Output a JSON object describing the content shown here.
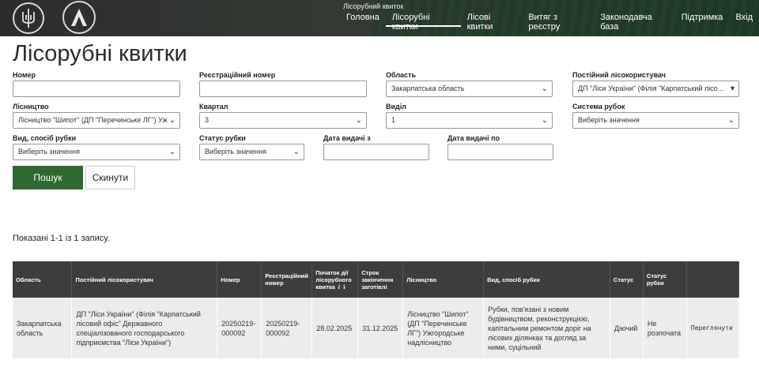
{
  "header": {
    "site_title": "Лісорубний квиток",
    "nav": [
      {
        "label": "Головна",
        "active": false
      },
      {
        "label": "Лісорубні квитки",
        "active": true
      },
      {
        "label": "Лісові квитки",
        "active": false
      },
      {
        "label": "Витяг з реєстру",
        "active": false
      },
      {
        "label": "Законодавча база",
        "active": false
      },
      {
        "label": "Підтримка",
        "active": false
      },
      {
        "label": "Вхід",
        "active": false
      }
    ]
  },
  "page_title": "Лісорубні квитки",
  "form": {
    "nomer": {
      "label": "Номер",
      "value": ""
    },
    "reg_nomer": {
      "label": "Реєстраційний номер",
      "value": ""
    },
    "oblast": {
      "label": "Область",
      "value": "Закарпатська область"
    },
    "lisokorystuvach": {
      "label": "Постійний лісокористувач",
      "value": "ДП \"Ліси України\" (Філія \"Карпатський лісо..."
    },
    "lisnytstvo": {
      "label": "Лісництво",
      "value": "Лісництво \"Шипот\" (ДП \"Перечинське ЛГ\") Уж"
    },
    "kvartal": {
      "label": "Квартал",
      "value": "3"
    },
    "vydil": {
      "label": "Виділ",
      "value": "1"
    },
    "systema": {
      "label": "Система рубок",
      "value": "Виберіть значення"
    },
    "vyd_sposib": {
      "label": "Вид, спосіб рубки",
      "value": "Виберіть значення"
    },
    "status": {
      "label": "Статус рубки",
      "value": "Виберіть значення"
    },
    "data_z": {
      "label": "Дата видачі з",
      "value": ""
    },
    "data_po": {
      "label": "Дата видачі по",
      "value": ""
    },
    "search_label": "Пошук",
    "reset_label": "Скинути"
  },
  "summary": "Показані 1-1 із 1 запису.",
  "table": {
    "headers": [
      "Область",
      "Постійний лісокористувач",
      "Номер",
      "Реєстраційний номер",
      "Початок дії лісорубного квитка ⇃⇂",
      "Строк закінчення заготівлі",
      "Лісництво",
      "Вид, спосіб рубки",
      "Статус",
      "Статус рубки",
      ""
    ],
    "rows": [
      [
        "Закарпатська область",
        "ДП \"Ліси України\" (Філія \"Карпатський лісовий офіс\" Державного спеціалізованого господарського підприємства \"Ліси України\")",
        "20250219-000092",
        "20250219-000092",
        "28.02.2025",
        "31.12.2025",
        "Лісництво \"Шипот\" (ДП \"Перечинське ЛГ\") Ужгородське надлісництво",
        "Рубки, пов'язані з новим будівництвом, реконструкцією, капітальним ремонтом доріг на лісових ділянках та догляд за ними, суцільний",
        "Діючий",
        "Не розпочата",
        "Переглянути"
      ]
    ]
  }
}
